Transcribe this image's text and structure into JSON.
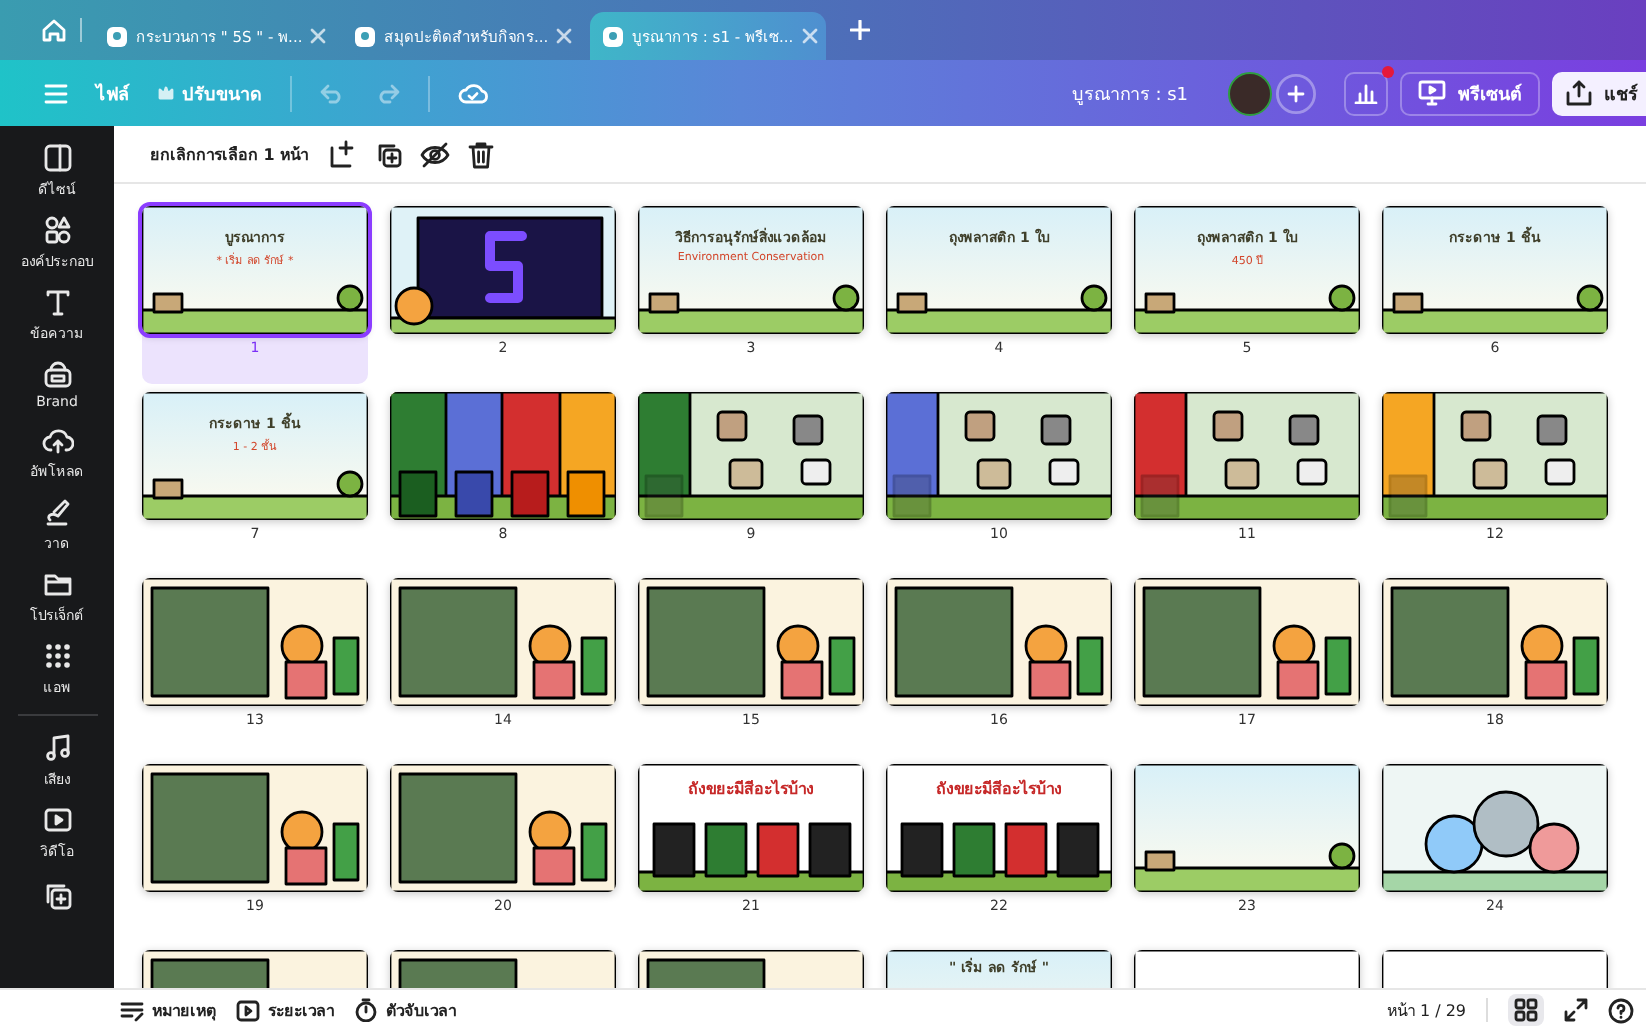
{
  "browser_tabs": [
    {
      "title": "กระบวนการ \" 5S \" - พ...",
      "selected": false
    },
    {
      "title": "สมุดปะติดสำหรับกิจกร...",
      "selected": false
    },
    {
      "title": "บูรณาการ : s1 - พรีเซ...",
      "selected": true
    }
  ],
  "toolbar": {
    "file": "ไฟล์",
    "resize": "ปรับขนาด",
    "project_title": "บูรณาการ : s1",
    "present": "พรีเซนต์",
    "share": "แชร์",
    "analytics_notification": true
  },
  "sidebar": {
    "items": [
      {
        "label": "ดีไซน์"
      },
      {
        "label": "องค์ประกอบ"
      },
      {
        "label": "ข้อความ"
      },
      {
        "label": "Brand"
      },
      {
        "label": "อัพโหลด"
      },
      {
        "label": "วาด"
      },
      {
        "label": "โปรเจ็กต์"
      },
      {
        "label": "แอพ"
      },
      {
        "label": "เสียง"
      },
      {
        "label": "วิดีโอ"
      }
    ]
  },
  "selection_bar": {
    "label": "ยกเลิกการเลือก 1 หน้า"
  },
  "slides": [
    {
      "number": "1",
      "kind": "scene",
      "selected": true,
      "title": "บูรณาการ",
      "subtitle": "* เริ่ม ลด รักษ์ *"
    },
    {
      "number": "2",
      "kind": "dark",
      "selected": false
    },
    {
      "number": "3",
      "kind": "scene",
      "selected": false,
      "title": "วิธีการอนุรักษ์สิ่งแวดล้อม",
      "subtitle": "Environment Conservation"
    },
    {
      "number": "4",
      "kind": "scene",
      "selected": false,
      "title": "ถุงพลาสติก 1 ใบ"
    },
    {
      "number": "5",
      "kind": "scene",
      "selected": false,
      "title": "ถุงพลาสติก 1 ใบ",
      "subtitle": "450 ปี"
    },
    {
      "number": "6",
      "kind": "scene",
      "selected": false,
      "title": "กระดาษ 1 ชิ้น"
    },
    {
      "number": "7",
      "kind": "scene",
      "selected": false,
      "title": "กระดาษ 1 ชิ้น",
      "subtitle": "1 - 2 ชั้น"
    },
    {
      "number": "8",
      "kind": "bins",
      "selected": false
    },
    {
      "number": "9",
      "kind": "sort",
      "selected": false,
      "color": "#2e7d32"
    },
    {
      "number": "10",
      "kind": "sort",
      "selected": false,
      "color": "#5b6fd6"
    },
    {
      "number": "11",
      "kind": "sort",
      "selected": false,
      "color": "#d32f2f"
    },
    {
      "number": "12",
      "kind": "sort",
      "selected": false,
      "color": "#f5a623"
    },
    {
      "number": "13",
      "kind": "photo",
      "selected": false
    },
    {
      "number": "14",
      "kind": "photo",
      "selected": false
    },
    {
      "number": "15",
      "kind": "photo",
      "selected": false
    },
    {
      "number": "16",
      "kind": "photo",
      "selected": false
    },
    {
      "number": "17",
      "kind": "photo",
      "selected": false
    },
    {
      "number": "18",
      "kind": "photo",
      "selected": false
    },
    {
      "number": "19",
      "kind": "photo",
      "selected": false
    },
    {
      "number": "20",
      "kind": "photo",
      "selected": false
    },
    {
      "number": "21",
      "kind": "binrow",
      "selected": false,
      "title": "ถังขยะมีสีอะไรบ้าง"
    },
    {
      "number": "22",
      "kind": "binrow",
      "selected": false,
      "title": "ถังขยะมีสีอะไรบ้าง"
    },
    {
      "number": "23",
      "kind": "scene",
      "selected": false
    },
    {
      "number": "24",
      "kind": "pile",
      "selected": false
    }
  ],
  "partial_slides": [
    {
      "kind": "photo"
    },
    {
      "kind": "photo"
    },
    {
      "kind": "photo"
    },
    {
      "kind": "scene",
      "title": "\" เริ่ม ลด รักษ์ \""
    },
    {
      "kind": "blank"
    },
    {
      "kind": "blank"
    }
  ],
  "bottom_bar": {
    "notes": "หมายเหตุ",
    "duration": "ระยะเวลา",
    "timer": "ตัวจับเวลา",
    "page": "หน้า 1 / 29"
  }
}
